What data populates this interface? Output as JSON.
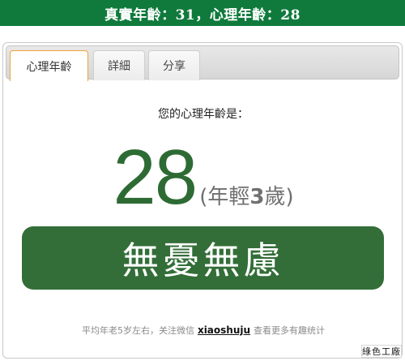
{
  "banner": {
    "text": "真實年齡：31，心理年齡：28"
  },
  "tabs": [
    {
      "label": "心理年齡",
      "active": true
    },
    {
      "label": "詳細",
      "active": false
    },
    {
      "label": "分享",
      "active": false
    }
  ],
  "result": {
    "prompt": "您的心理年齡是：",
    "age": "28",
    "paren_open": "(年輕",
    "diff": "3",
    "paren_close": "歲)",
    "verdict": "無憂無慮"
  },
  "footer": {
    "before": "平均年老5岁左右，关注微信",
    "wechat_id": "xiaoshuju",
    "after": "查看更多有趣统计"
  },
  "watermark": {
    "text": "綠色工廠"
  },
  "colors": {
    "banner_bg": "#0f7a3c",
    "age_green": "#2e6b34",
    "verdict_bg": "#336e38",
    "tab_active_border": "#f0a33a"
  }
}
